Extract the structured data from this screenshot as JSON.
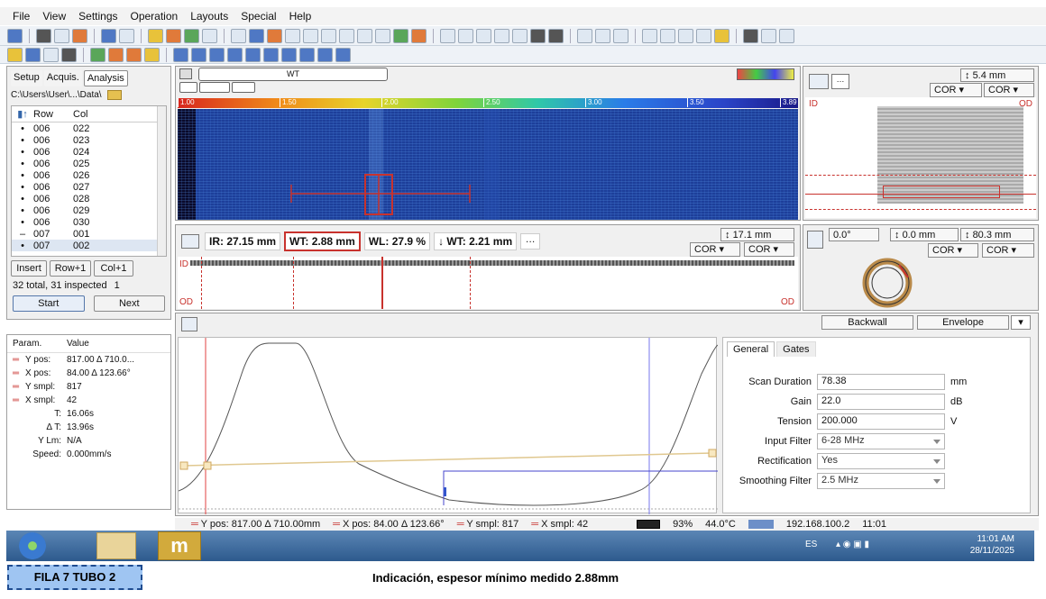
{
  "menu": [
    "File",
    "View",
    "Settings",
    "Operation",
    "Layouts",
    "Special",
    "Help"
  ],
  "left": {
    "tabs": [
      "Setup",
      "Acquis.",
      "Analysis"
    ],
    "path": "C:\\Users\\User\\...\\Data\\",
    "table_headers": [
      "Row",
      "Col"
    ],
    "rows": [
      [
        "006",
        "022"
      ],
      [
        "006",
        "023"
      ],
      [
        "006",
        "024"
      ],
      [
        "006",
        "025"
      ],
      [
        "006",
        "026"
      ],
      [
        "006",
        "027"
      ],
      [
        "006",
        "028"
      ],
      [
        "006",
        "029"
      ],
      [
        "006",
        "030"
      ],
      [
        "007",
        "001"
      ],
      [
        "007",
        "002"
      ]
    ],
    "buttons": [
      "Insert",
      "Row+1",
      "Col+1"
    ],
    "total": "32 total, 31 inspected",
    "total_count": "1",
    "start": "Start",
    "next": "Next",
    "param_header": "Param.",
    "value_header": "Value",
    "params": [
      {
        "name": "Y pos:",
        "value": "817.00 Δ 710.0..."
      },
      {
        "name": "X pos:",
        "value": "84.00 Δ 123.66°"
      },
      {
        "name": "Y smpl:",
        "value": "817"
      },
      {
        "name": "X smpl:",
        "value": "42"
      },
      {
        "name": "T:",
        "value": "16.06s"
      },
      {
        "name": "Δ T:",
        "value": "13.96s"
      },
      {
        "name": "Y Lm:",
        "value": "N/A"
      },
      {
        "name": "Speed:",
        "value": "0.000mm/s"
      }
    ]
  },
  "cscan": {
    "title": "WT",
    "scale_ticks": [
      "1.00",
      "1.50",
      "2.00",
      "2.50",
      "3.00",
      "3.50",
      "3.89"
    ]
  },
  "right_top": {
    "size": "5.4 mm",
    "cor1": "COR",
    "cor2": "COR",
    "id": "ID",
    "od": "OD"
  },
  "bscan": {
    "ir": "IR: 27.15 mm",
    "wt": "WT: 2.88 mm",
    "wl": "WL: 27.9 %",
    "min_wt": "↓ WT: 2.21 mm",
    "size": "17.1 mm",
    "cor1": "COR",
    "cor2": "COR",
    "id": "ID",
    "od": "OD"
  },
  "ring": {
    "angle": "0.0°",
    "pos": "0.0 mm",
    "size": "80.3 mm",
    "cor1": "COR",
    "cor2": "COR"
  },
  "ascan": {
    "backwall": "Backwall",
    "envelope": "Envelope"
  },
  "settings": {
    "tabs": [
      "General",
      "Gates"
    ],
    "fields": [
      {
        "label": "Scan Duration",
        "value": "78.38",
        "unit": "mm"
      },
      {
        "label": "Gain",
        "value": "22.0",
        "unit": "dB"
      },
      {
        "label": "Tension",
        "value": "200.000",
        "unit": "V"
      }
    ],
    "selects": [
      {
        "label": "Input Filter",
        "value": "6-28 MHz"
      },
      {
        "label": "Rectification",
        "value": "Yes"
      },
      {
        "label": "Smoothing Filter",
        "value": "2.5 MHz"
      }
    ]
  },
  "status": {
    "ypos": "Y pos: 817.00 Δ 710.00mm",
    "xpos": "X pos: 84.00 Δ 123.66°",
    "ysmpl": "Y smpl: 817",
    "xsmpl": "X smpl: 42",
    "battery": "93%",
    "temp": "44.0°C",
    "ip": "192.168.100.2",
    "time": "11:01"
  },
  "taskbar": {
    "lang": "ES",
    "time": "11:01 AM",
    "date": "28/11/2025"
  },
  "caption_label": "FILA 7 TUBO 2",
  "caption_text": "Indicación, espesor mínimo medido 2.88mm",
  "colors": {
    "accent": "#c8322d",
    "scan_bg": "#1840a0"
  }
}
